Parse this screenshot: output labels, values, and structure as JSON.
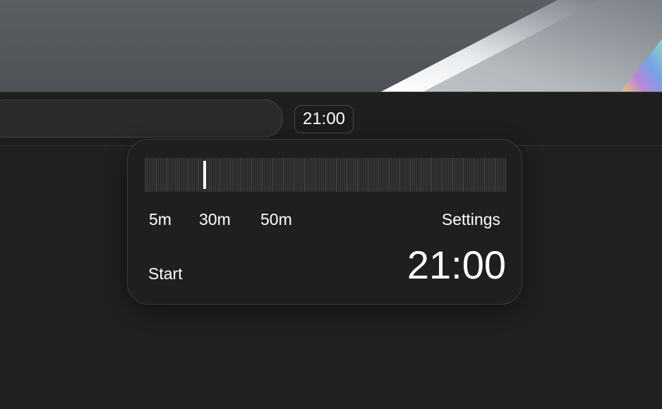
{
  "toolbar": {
    "time_chip": "21:00"
  },
  "timer_popup": {
    "presets": [
      "5m",
      "30m",
      "50m"
    ],
    "settings_label": "Settings",
    "start_label": "Start",
    "time_display": "21:00",
    "slider_value_minutes": 21
  },
  "colors": {
    "background": "#202020",
    "panel": "#1f1f1f",
    "text": "#ffffff",
    "handle": "#ffffff"
  },
  "icons": [
    "duration-slider-ticks"
  ]
}
